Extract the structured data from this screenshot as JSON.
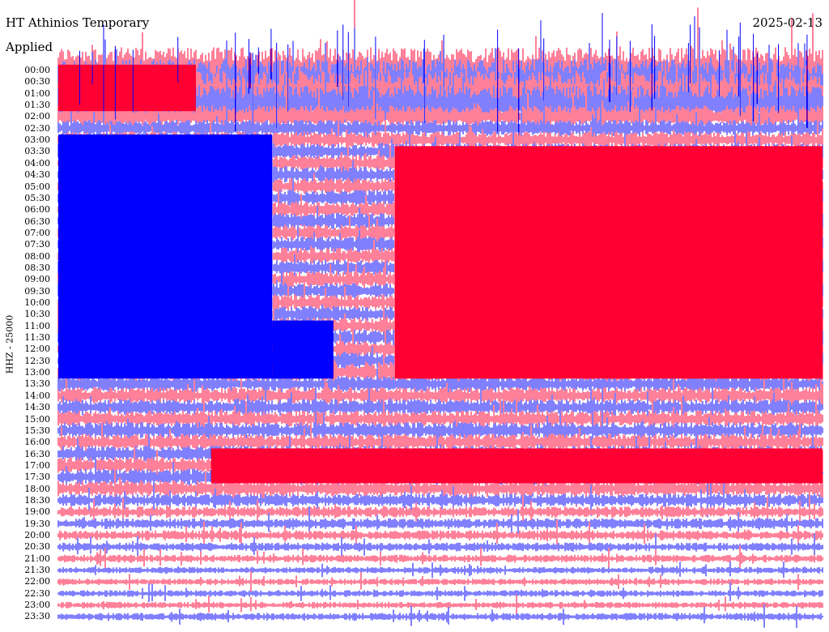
{
  "header": {
    "title": "HT Athinios Temporary",
    "subtitle": "Applied",
    "date": "2025-02-13",
    "ylabel": "HHZ - 25000"
  },
  "chart_data": {
    "type": "line",
    "kind": "helicorder",
    "title": "HT Athinios Temporary",
    "subtitle": "Applied",
    "ylabel": "HHZ - 25000",
    "row_labels": [
      "00:00",
      "00:30",
      "01:00",
      "01:30",
      "02:00",
      "02:30",
      "03:00",
      "03:30",
      "04:00",
      "04:30",
      "05:00",
      "05:30",
      "06:00",
      "06:30",
      "07:00",
      "07:30",
      "08:00",
      "08:30",
      "09:00",
      "09:30",
      "10:00",
      "10:30",
      "11:00",
      "11:30",
      "12:00",
      "12:30",
      "13:00",
      "13:30",
      "14:00",
      "14:30",
      "15:00",
      "15:30",
      "16:00",
      "16:30",
      "17:00",
      "17:30",
      "18:00",
      "18:30",
      "19:00",
      "19:30",
      "20:00",
      "20:30",
      "21:00",
      "21:30",
      "22:00",
      "22:30",
      "23:00",
      "23:30"
    ],
    "row_minutes": 30,
    "series_colors": [
      "#ff0033",
      "#0000ff"
    ],
    "row_amplitudes": [
      4,
      4,
      4,
      3.5,
      2,
      1.5,
      1.5,
      1.5,
      1.5,
      1.5,
      1.5,
      1.5,
      1.5,
      1.5,
      1.5,
      1.5,
      1.5,
      1.5,
      1.5,
      1.5,
      1.5,
      1.5,
      1.5,
      1.5,
      1.5,
      1.5,
      2,
      1.5,
      1.5,
      1.5,
      1.5,
      1.5,
      1.5,
      1.5,
      1.5,
      1.5,
      1.5,
      1.2,
      1,
      1,
      0.9,
      0.8,
      0.7,
      0.6,
      0.6,
      0.6,
      0.6,
      0.7
    ],
    "saturated_blocks": [
      {
        "from_row": 0,
        "to_row": 3,
        "x_start": 0.0,
        "x_end": 0.18,
        "color_index": 0
      },
      {
        "from_row": 6,
        "to_row": 26,
        "x_start": 0.0,
        "x_end": 0.28,
        "color_index": 1
      },
      {
        "from_row": 7,
        "to_row": 26,
        "x_start": 0.44,
        "x_end": 1.0,
        "color_index": 0
      },
      {
        "from_row": 22,
        "to_row": 26,
        "x_start": 0.28,
        "x_end": 0.36,
        "color_index": 1
      },
      {
        "from_row": 33,
        "to_row": 35,
        "x_start": 0.2,
        "x_end": 1.0,
        "color_index": 0
      }
    ]
  }
}
